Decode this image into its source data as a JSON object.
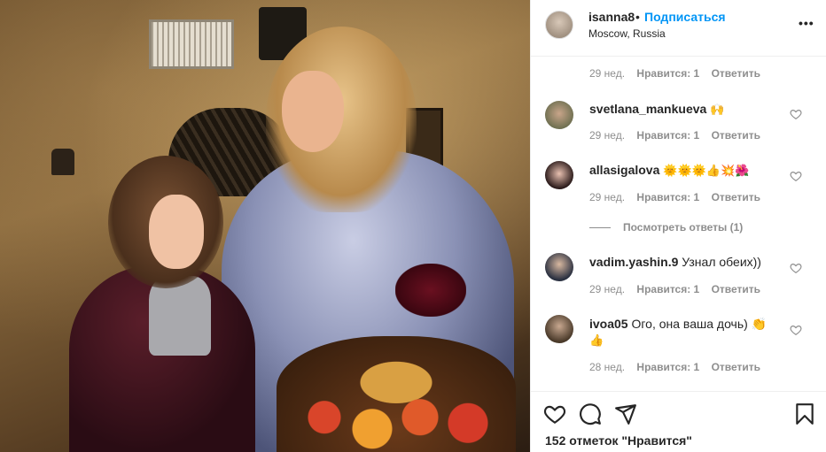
{
  "post": {
    "photo_alt": "",
    "header": {
      "username": "isanna8",
      "separator": "•",
      "follow_label": "Подписаться",
      "location": "Moscow, Russia",
      "more_label": "•••"
    },
    "comments": [
      {
        "meta": {
          "time": "29 нед.",
          "likes": "Нравится: 1",
          "reply": "Ответить"
        }
      },
      {
        "username": "svetlana_mankueva",
        "text": "🙌",
        "meta": {
          "time": "29 нед.",
          "likes": "Нравится: 1",
          "reply": "Ответить"
        }
      },
      {
        "username": "allasigalova",
        "text": "🌞🌞🌞👍💥🌺",
        "meta": {
          "time": "29 нед.",
          "likes": "Нравится: 1",
          "reply": "Ответить"
        }
      },
      {
        "username": "vadim.yashin.9",
        "text": "Узнал обеих))",
        "meta": {
          "time": "29 нед.",
          "likes": "Нравится: 1",
          "reply": "Ответить"
        }
      },
      {
        "username": "ivoa05",
        "text": "Ого, она ваша дочь) 👏",
        "text2": "👍",
        "meta": {
          "time": "28 нед.",
          "likes": "Нравится: 1",
          "reply": "Ответить"
        }
      }
    ],
    "view_replies": "Посмотреть ответы (1)",
    "likes_text": "152 отметок \"Нравится\""
  },
  "colors": {
    "accent": "#0095f6",
    "text": "#262626",
    "muted": "#8e8e8e",
    "border": "#efefef"
  },
  "icons": [
    "heart-icon",
    "comment-icon",
    "share-icon",
    "bookmark-icon",
    "more-icon"
  ]
}
